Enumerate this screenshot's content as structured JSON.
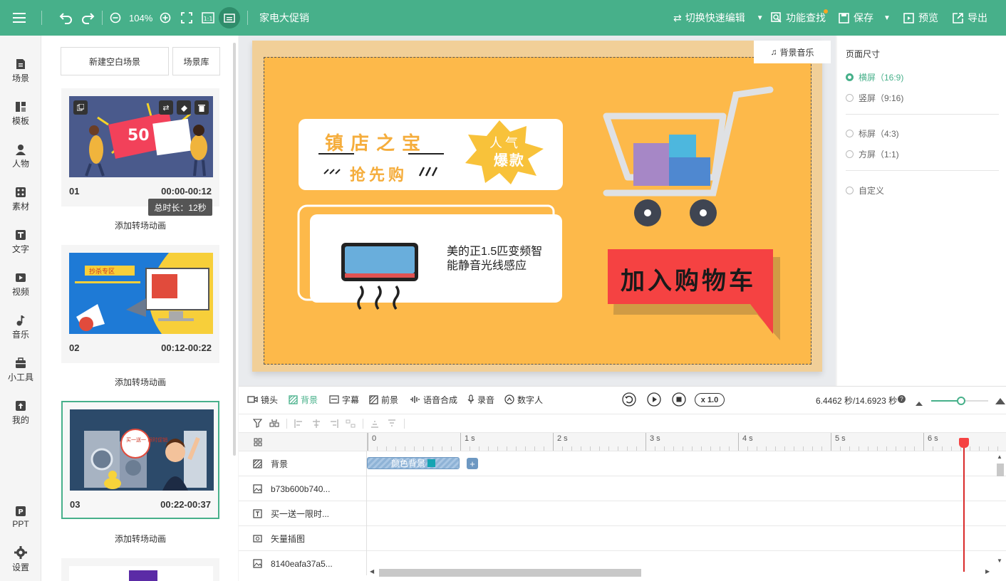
{
  "topbar": {
    "zoom": "104%",
    "project_title": "家电大促销",
    "quick_edit": "切换快速编辑",
    "feature_search": "功能查找",
    "save": "保存",
    "preview": "预览",
    "export": "导出"
  },
  "nav": [
    {
      "label": "场景",
      "icon": "scene-icon"
    },
    {
      "label": "模板",
      "icon": "template-icon"
    },
    {
      "label": "人物",
      "icon": "person-icon"
    },
    {
      "label": "素材",
      "icon": "material-icon"
    },
    {
      "label": "文字",
      "icon": "text-icon"
    },
    {
      "label": "视频",
      "icon": "video-icon"
    },
    {
      "label": "音乐",
      "icon": "music-icon"
    },
    {
      "label": "小工具",
      "icon": "toolbox-icon"
    },
    {
      "label": "我的",
      "icon": "upload-icon"
    },
    {
      "label": "PPT",
      "icon": "ppt-icon"
    },
    {
      "label": "设置",
      "icon": "gear-icon"
    }
  ],
  "scenes_panel": {
    "new_blank": "新建空白场景",
    "library": "场景库",
    "total_tooltip": "总时长：12秒",
    "transition_label": "添加转场动画",
    "scenes": [
      {
        "num": "01",
        "time": "00:00-00:12",
        "thumb_text": "50"
      },
      {
        "num": "02",
        "time": "00:12-00:22",
        "thumb_text": "抄杀专区"
      },
      {
        "num": "03",
        "time": "00:22-00:37",
        "thumb_text": "买一送一 限时促销"
      }
    ]
  },
  "canvas": {
    "bg_music": "背景音乐",
    "treasure_title": "镇店之宝",
    "grab_text": "抢先购",
    "popular_line1": "人气",
    "popular_line2": "爆款",
    "product_desc": "美的正1.5匹变频智能静音光线感应",
    "cart_button": "加入购物车",
    "colors": {
      "canvas_bg": "#fdb94a",
      "cart_red": "#f54242",
      "accent": "#47b08a"
    }
  },
  "page_size": {
    "title": "页面尺寸",
    "options": [
      {
        "label": "横屏（16:9)",
        "selected": true
      },
      {
        "label": "竖屏（9:16)",
        "selected": false
      },
      {
        "label": "标屏（4:3)",
        "selected": false
      },
      {
        "label": "方屏（1:1)",
        "selected": false
      },
      {
        "label": "自定义",
        "selected": false
      }
    ]
  },
  "timeline": {
    "tools": [
      "镜头",
      "背景",
      "字幕",
      "前景",
      "语音合成",
      "录音",
      "数字人"
    ],
    "speed": "x 1.0",
    "time_readout": "6.4462 秒/14.6923 秒",
    "ruler": [
      "0",
      "1 s",
      "2 s",
      "3 s",
      "4 s",
      "5 s",
      "6 s"
    ],
    "playhead_seconds": 6.4462,
    "total_seconds": 14.6923,
    "tracks": [
      {
        "label": "背景",
        "icon": "background-icon"
      },
      {
        "label": "b73b600b740...",
        "icon": "image-icon"
      },
      {
        "label": "买一送一限时...",
        "icon": "text-icon"
      },
      {
        "label": "矢量插图",
        "icon": "vector-icon"
      },
      {
        "label": "8140eafa37a5...",
        "icon": "image-icon"
      }
    ],
    "bg_clip": "颜色背景"
  }
}
